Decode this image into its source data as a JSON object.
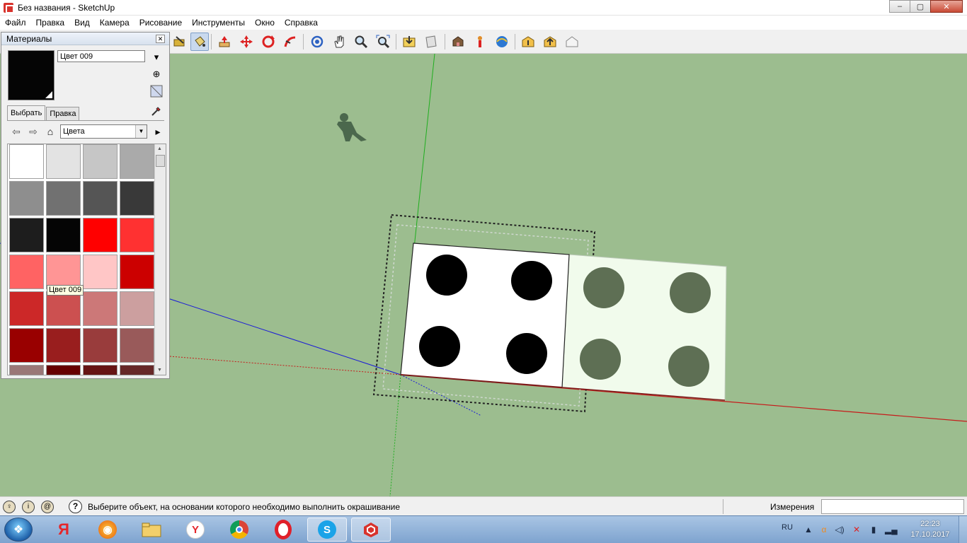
{
  "window": {
    "title": "Без названия - SketchUp",
    "buttons": [
      "–",
      "▢",
      "✕"
    ]
  },
  "menu": [
    "Файл",
    "Правка",
    "Вид",
    "Камера",
    "Рисование",
    "Инструменты",
    "Окно",
    "Справка"
  ],
  "toolbar": {
    "icons": [
      "tape-measure-icon",
      "paint-bucket-icon",
      "push-pull-icon",
      "move-icon",
      "rotate-icon",
      "follow-me-icon",
      "orbit-icon",
      "pan-icon",
      "zoom-icon",
      "zoom-extents-icon",
      "get-models-icon",
      "share-model-icon",
      "component-icon",
      "geo-location-icon",
      "google-earth-icon",
      "extension-warehouse-icon",
      "upload-icon",
      "house-icon"
    ],
    "active": "paint-bucket-icon"
  },
  "materials": {
    "title": "Материалы",
    "material_name": "Цвет 009",
    "tabs": [
      "Выбрать",
      "Правка"
    ],
    "collection": "Цвета",
    "tooltip": "Цвет 009",
    "swatches": [
      "#ffffff",
      "#e3e3e3",
      "#c6c6c6",
      "#aaaaaa",
      "#8e8e8e",
      "#717171",
      "#555555",
      "#393939",
      "#1d1d1d",
      "#050505",
      "#ff0000",
      "#ff3131",
      "#ff6363",
      "#ff9595",
      "#ffc6c6",
      "#cc0000",
      "#cc2828",
      "#cc5050",
      "#cc7878",
      "#cc9f9f",
      "#990000",
      "#991e1e",
      "#993c3c",
      "#995a5a",
      "#9a7777",
      "#660000",
      "#661414",
      "#662828"
    ]
  },
  "status": {
    "message": "Выберите объект, на основании которого необходимо выполнить окрашивание",
    "measurements_label": "Измерения",
    "measurements_value": ""
  },
  "taskbar": {
    "apps": [
      "yandex-app-icon",
      "firefox-icon",
      "file-explorer-icon",
      "yandex-browser-icon",
      "chrome-icon",
      "opera-icon",
      "skype-icon",
      "sketchup-icon"
    ],
    "language": "RU",
    "time": "22:23",
    "date": "17.10.2017"
  }
}
